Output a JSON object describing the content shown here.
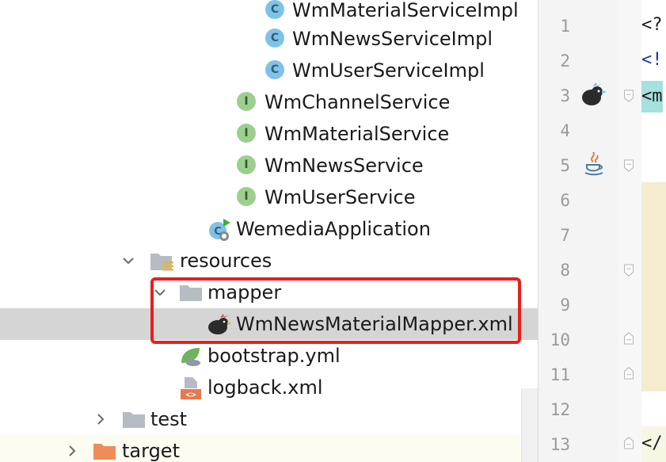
{
  "project_tree": {
    "items": [
      {
        "label": "WmMaterialServiceImpl",
        "kind": "class"
      },
      {
        "label": "WmNewsServiceImpl",
        "kind": "class"
      },
      {
        "label": "WmUserServiceImpl",
        "kind": "class"
      },
      {
        "label": "WmChannelService",
        "kind": "interface"
      },
      {
        "label": "WmMaterialService",
        "kind": "interface"
      },
      {
        "label": "WmNewsService",
        "kind": "interface"
      },
      {
        "label": "WmUserService",
        "kind": "interface"
      },
      {
        "label": "WemediaApplication",
        "kind": "spring-boot-class"
      },
      {
        "label": "resources",
        "kind": "resources-folder",
        "expanded": true
      },
      {
        "label": "mapper",
        "kind": "folder",
        "expanded": true
      },
      {
        "label": "WmNewsMaterialMapper.xml",
        "kind": "mybatis-xml",
        "selected": true
      },
      {
        "label": "bootstrap.yml",
        "kind": "spring-yml"
      },
      {
        "label": "logback.xml",
        "kind": "xml"
      },
      {
        "label": "test",
        "kind": "folder",
        "expanded": false
      },
      {
        "label": "target",
        "kind": "excluded-folder",
        "expanded": false
      }
    ]
  },
  "editor": {
    "line_numbers": [
      "1",
      "2",
      "3",
      "4",
      "5",
      "6",
      "7",
      "8",
      "9",
      "10",
      "11",
      "12",
      "13"
    ],
    "code_fragments": {
      "line1": "<?",
      "line2": "<!",
      "line3": "<m",
      "line13": "</"
    }
  },
  "colors": {
    "selection": "#d5d5d5",
    "highlight_box": "#e5201d",
    "class_badge": "#7ec3e6",
    "interface_badge": "#9ccf8f"
  }
}
